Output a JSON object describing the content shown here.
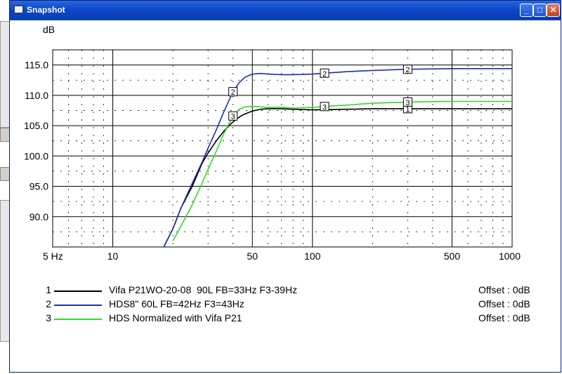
{
  "window": {
    "title": "Snapshot",
    "minimize": "_",
    "maximize": "□",
    "close": "✕"
  },
  "chart_data": {
    "type": "line",
    "title": "",
    "ylabel": "dB",
    "xlabel": "",
    "x_scale": "log",
    "xlim": [
      5,
      1000
    ],
    "ylim": [
      85,
      117.5
    ],
    "x_ticks": [
      {
        "value": 5,
        "label": "5 Hz"
      },
      {
        "value": 10,
        "label": "10"
      },
      {
        "value": 50,
        "label": "50"
      },
      {
        "value": 100,
        "label": "100"
      },
      {
        "value": 500,
        "label": "500"
      },
      {
        "value": 1000,
        "label": "1000"
      }
    ],
    "y_ticks": [
      {
        "value": 115,
        "label": "115.0"
      },
      {
        "value": 110,
        "label": "110.0"
      },
      {
        "value": 105,
        "label": "105.0"
      },
      {
        "value": 100,
        "label": "100.0"
      },
      {
        "value": 95,
        "label": "95.0"
      },
      {
        "value": 90,
        "label": "90.0"
      }
    ],
    "grid": true,
    "series": [
      {
        "marker": "1",
        "name": "Vifa P21WO-20-08  90L FB=33Hz F3-39Hz",
        "color": "#000000",
        "marker_positions": [
          300
        ],
        "x": [
          18,
          20,
          22,
          25,
          28,
          30,
          33,
          36,
          39,
          42,
          45,
          50,
          55,
          60,
          70,
          80,
          100,
          150,
          200,
          300,
          500,
          1000
        ],
        "y": [
          85,
          88,
          91.5,
          95,
          98.8,
          100.5,
          102.5,
          104.1,
          105.3,
          106.2,
          106.8,
          107.4,
          107.7,
          107.8,
          107.8,
          107.7,
          107.6,
          107.7,
          107.8,
          107.8,
          107.8,
          107.8
        ]
      },
      {
        "marker": "2",
        "name": "HDS8\" 60L FB=42Hz F3=43Hz",
        "color": "#1f2fa6",
        "marker_positions": [
          40,
          115,
          300
        ],
        "x": [
          18,
          20,
          22,
          25,
          28,
          30,
          33,
          36,
          40,
          43,
          46,
          50,
          55,
          60,
          70,
          80,
          100,
          120,
          150,
          200,
          300,
          500,
          1000
        ],
        "y": [
          85,
          88,
          91.5,
          95.5,
          99,
          101.3,
          104.3,
          107.3,
          110.6,
          112.1,
          113,
          113.5,
          113.6,
          113.5,
          113.4,
          113.4,
          113.5,
          113.7,
          113.9,
          114.1,
          114.3,
          114.4,
          114.4
        ]
      },
      {
        "marker": "3",
        "name": "HDS Normalized with Vifa P21",
        "color": "#2ddc2d",
        "marker_positions": [
          40,
          115,
          300
        ],
        "x": [
          20,
          22,
          25,
          28,
          30,
          33,
          36,
          40,
          43,
          46,
          50,
          55,
          60,
          70,
          80,
          100,
          120,
          150,
          200,
          300,
          500,
          1000
        ],
        "y": [
          86,
          88.5,
          92,
          95.5,
          97.8,
          100.8,
          103.7,
          106.6,
          107.7,
          108.1,
          108.2,
          108.1,
          108,
          108,
          107.9,
          108,
          108.2,
          108.4,
          108.7,
          108.9,
          109,
          109
        ]
      }
    ],
    "legend": [
      {
        "num": "1",
        "label": "Vifa P21WO-20-08  90L FB=33Hz F3-39Hz",
        "offset": "Offset : 0dB",
        "color": "#000000"
      },
      {
        "num": "2",
        "label": "HDS8\" 60L FB=42Hz F3=43Hz",
        "offset": "Offset : 0dB",
        "color": "#1f2fa6"
      },
      {
        "num": "3",
        "label": "HDS Normalized with Vifa P21",
        "offset": "Offset : 0dB",
        "color": "#2ddc2d"
      }
    ],
    "legend_position": "bottom"
  }
}
